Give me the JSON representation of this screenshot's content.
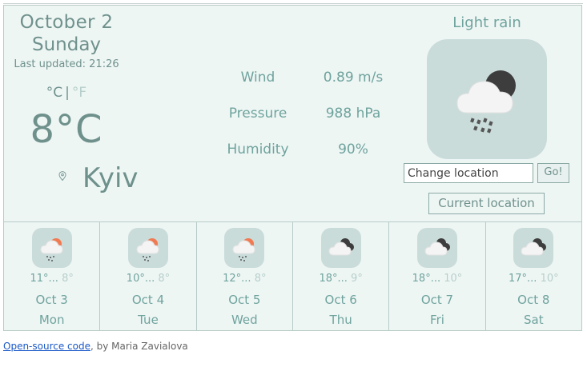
{
  "current": {
    "date": "October 2",
    "day": "Sunday",
    "last_updated": "Last updated: 21:26",
    "unit_c": "°C",
    "unit_sep": "|",
    "unit_f": "°F",
    "temperature": "8°C",
    "city": "Kyiv",
    "condition": "Light rain",
    "icon": "cloud-sun-rain-icon"
  },
  "stats": [
    {
      "label": "Wind",
      "value": "0.89 m/s"
    },
    {
      "label": "Pressure",
      "value": "988 hPa"
    },
    {
      "label": "Humidity",
      "value": "90%"
    }
  ],
  "search": {
    "placeholder": "Change location",
    "go_label": "Go!",
    "current_location_label": "Current location"
  },
  "forecast": [
    {
      "max": "11°...",
      "min": "8°",
      "date": "Oct 3",
      "day": "Mon",
      "icon": "cloud-sun-rain-icon"
    },
    {
      "max": "10°...",
      "min": "8°",
      "date": "Oct 4",
      "day": "Tue",
      "icon": "cloud-sun-rain-icon"
    },
    {
      "max": "12°...",
      "min": "8°",
      "date": "Oct 5",
      "day": "Wed",
      "icon": "cloud-sun-rain-icon"
    },
    {
      "max": "18°...",
      "min": "9°",
      "date": "Oct 6",
      "day": "Thu",
      "icon": "cloud-moon-icon"
    },
    {
      "max": "18°...",
      "min": "10°",
      "date": "Oct 7",
      "day": "Fri",
      "icon": "cloud-moon-icon"
    },
    {
      "max": "17°...",
      "min": "10°",
      "date": "Oct 8",
      "day": "Sat",
      "icon": "cloud-moon-icon"
    }
  ],
  "footer": {
    "link_text": "Open-source code",
    "author_text": ", by Maria Zavialova"
  },
  "colors": {
    "card_background": "#eef6f4",
    "icon_background": "#c9dcda",
    "text": "#6f918c",
    "sun": "#f07a52",
    "moon": "#3d3d3d"
  }
}
